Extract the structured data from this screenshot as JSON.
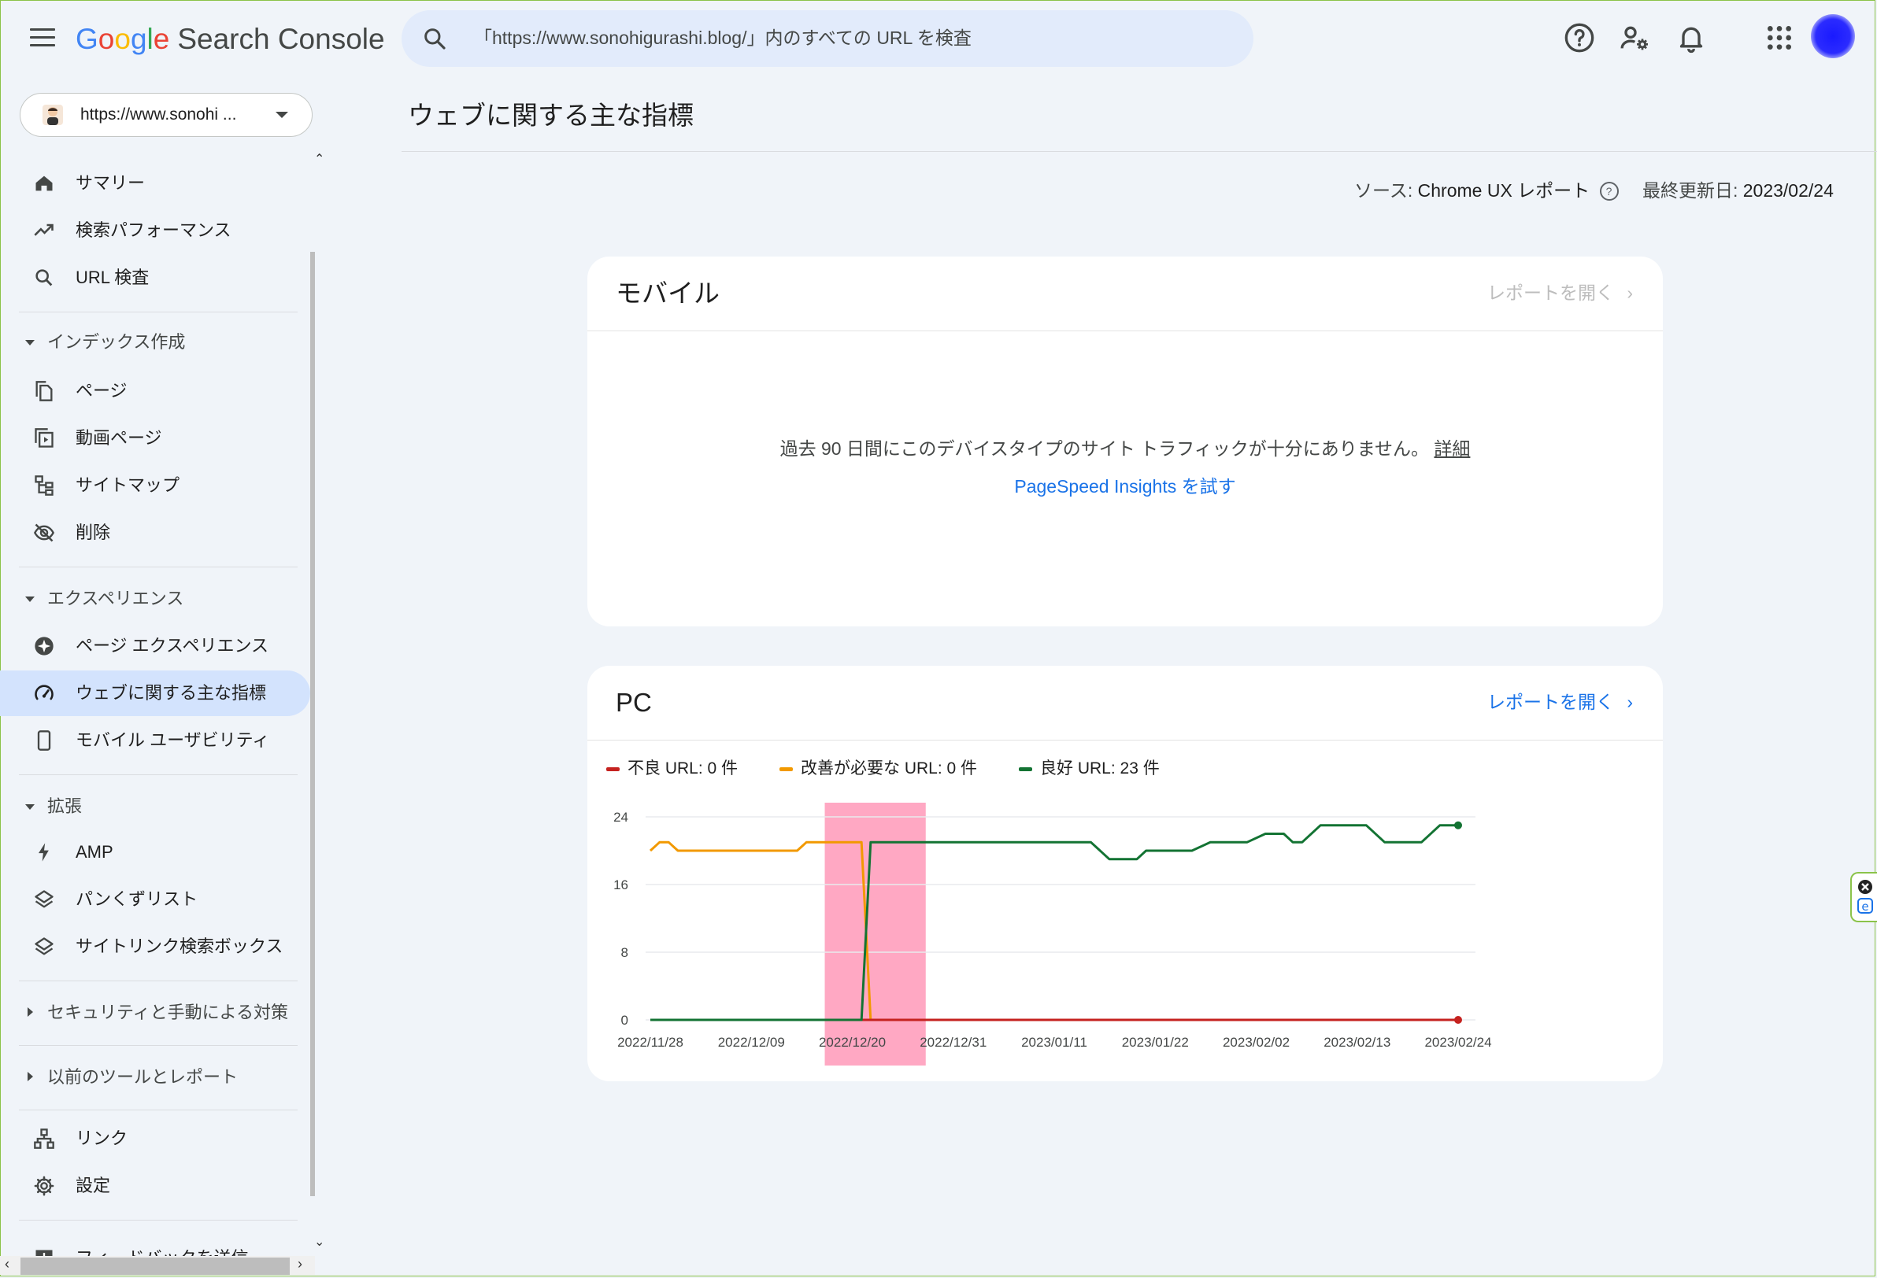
{
  "header": {
    "logo_google": [
      "G",
      "o",
      "o",
      "g",
      "l",
      "e"
    ],
    "logo_product": "Search Console",
    "search_text": "「https://www.sonohigurashi.blog/」内のすべての URL を検査"
  },
  "sidebar": {
    "property": "https://www.sonohi ...",
    "items": {
      "summary": "サマリー",
      "performance": "検索パフォーマンス",
      "url_inspection": "URL 検査",
      "pages": "ページ",
      "video_pages": "動画ページ",
      "sitemaps": "サイトマップ",
      "removals": "削除",
      "page_experience": "ページ エクスペリエンス",
      "core_web_vitals": "ウェブに関する主な指標",
      "mobile_usability": "モバイル ユーザビリティ",
      "amp": "AMP",
      "breadcrumbs": "パンくずリスト",
      "sitelinks_searchbox": "サイトリンク検索ボックス",
      "links": "リンク",
      "settings": "設定",
      "feedback": "フィードバックを送信"
    },
    "sections": {
      "index": "インデックス作成",
      "experience": "エクスペリエンス",
      "enhancements": "拡張",
      "security": "セキュリティと手動による対策",
      "legacy": "以前のツールとレポート"
    }
  },
  "main": {
    "title": "ウェブに関する主な指標",
    "source_label": "ソース:",
    "source_value": "Chrome UX レポート",
    "updated_label": "最終更新日:",
    "updated_value": "2023/02/24",
    "mobile": {
      "title": "モバイル",
      "open_report": "レポートを開く",
      "message": "過去 90 日間にこのデバイスタイプのサイト トラフィックが十分にありません。",
      "details_link": "詳細",
      "psi_link": "PageSpeed Insights を試す"
    },
    "pc": {
      "title": "PC",
      "open_report": "レポートを開く",
      "legend": {
        "poor": "不良 URL: 0 件",
        "needs_improvement": "改善が必要な URL: 0 件",
        "good": "良好 URL: 23 件"
      }
    }
  },
  "colors": {
    "poor": "#c5221f",
    "needs_improvement": "#f29900",
    "good": "#137333",
    "highlight": "#ff99b8",
    "link": "#1a73e8",
    "active_nav": "#d3e3fd"
  },
  "chart_data": {
    "type": "line",
    "x_tick_labels": [
      "2022/11/28",
      "2022/12/09",
      "2022/12/20",
      "2022/12/31",
      "2023/01/11",
      "2023/01/22",
      "2023/02/02",
      "2023/02/13",
      "2023/02/24"
    ],
    "ylim": [
      0,
      24
    ],
    "y_ticks": [
      0,
      8,
      16,
      24
    ],
    "grid": true,
    "highlight_range": [
      "2022/12/17",
      "2022/12/28"
    ],
    "series": [
      {
        "name": "不良",
        "color": "#c5221f",
        "points": [
          [
            "2022/11/28",
            0
          ],
          [
            "2023/02/24",
            0
          ]
        ]
      },
      {
        "name": "改善が必要",
        "color": "#f29900",
        "points": [
          [
            "2022/11/28",
            20
          ],
          [
            "2022/11/29",
            21
          ],
          [
            "2022/11/30",
            21
          ],
          [
            "2022/12/01",
            20
          ],
          [
            "2022/12/14",
            20
          ],
          [
            "2022/12/15",
            21
          ],
          [
            "2022/12/20",
            21
          ],
          [
            "2022/12/21",
            21
          ],
          [
            "2022/12/22",
            0
          ],
          [
            "2023/02/24",
            0
          ]
        ]
      },
      {
        "name": "良好",
        "color": "#137333",
        "points": [
          [
            "2022/11/28",
            0
          ],
          [
            "2022/12/21",
            0
          ],
          [
            "2022/12/22",
            21
          ],
          [
            "2023/01/15",
            21
          ],
          [
            "2023/01/17",
            19
          ],
          [
            "2023/01/20",
            19
          ],
          [
            "2023/01/21",
            20
          ],
          [
            "2023/01/26",
            20
          ],
          [
            "2023/01/28",
            21
          ],
          [
            "2023/02/01",
            21
          ],
          [
            "2023/02/03",
            22
          ],
          [
            "2023/02/05",
            22
          ],
          [
            "2023/02/06",
            21
          ],
          [
            "2023/02/07",
            21
          ],
          [
            "2023/02/09",
            23
          ],
          [
            "2023/02/14",
            23
          ],
          [
            "2023/02/16",
            21
          ],
          [
            "2023/02/20",
            21
          ],
          [
            "2023/02/22",
            23
          ],
          [
            "2023/02/24",
            23
          ]
        ]
      }
    ]
  }
}
